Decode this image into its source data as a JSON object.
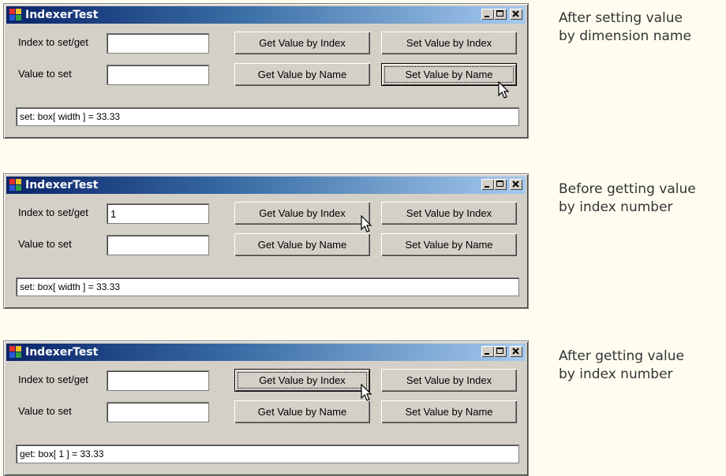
{
  "screens": [
    {
      "window_title": "IndexerTest",
      "index_label": "Index to set/get",
      "value_label": "Value to set",
      "index_value": "",
      "value_value": "",
      "btn_get_index": "Get Value by Index",
      "btn_set_index": "Set Value by Index",
      "btn_get_name": "Get Value by Name",
      "btn_set_name": "Set Value by Name",
      "output": "set: box[ width ] = 33.33",
      "caption_line1": "After setting value",
      "caption_line2": "by dimension name"
    },
    {
      "window_title": "IndexerTest",
      "index_label": "Index to set/get",
      "value_label": "Value to set",
      "index_value": "1",
      "value_value": "",
      "btn_get_index": "Get Value by Index",
      "btn_set_index": "Set Value by Index",
      "btn_get_name": "Get Value by Name",
      "btn_set_name": "Set Value by Name",
      "output": "set: box[ width ] = 33.33",
      "caption_line1": "Before getting value",
      "caption_line2": "by index number"
    },
    {
      "window_title": "IndexerTest",
      "index_label": "Index to set/get",
      "value_label": "Value to set",
      "index_value": "",
      "value_value": "",
      "btn_get_index": "Get Value by Index",
      "btn_set_index": "Set Value by Index",
      "btn_get_name": "Get Value by Name",
      "btn_set_name": "Set Value by Name",
      "output": "get: box[ 1 ] = 33.33",
      "caption_line1": "After getting value",
      "caption_line2": "by index number"
    }
  ]
}
